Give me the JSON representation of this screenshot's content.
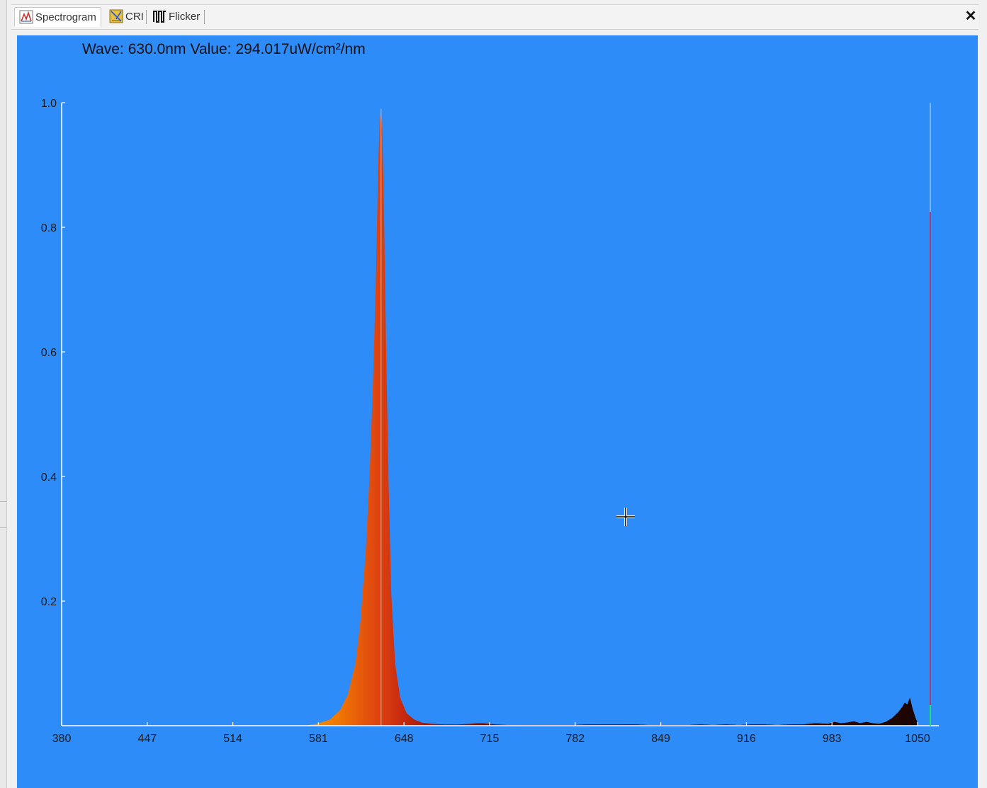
{
  "tabs": [
    {
      "label": "Spectrogram",
      "icon": "spectrogram-icon",
      "active": true
    },
    {
      "label": "CRI",
      "icon": "cri-icon",
      "active": false
    },
    {
      "label": "Flicker",
      "icon": "flicker-icon",
      "active": false
    }
  ],
  "close_label": "✕",
  "readout": {
    "wave_label": "Wave:",
    "wave_value": "630.0nm",
    "value_label": "Value:",
    "value_value": "294.017uW/cm²/nm"
  },
  "colors": {
    "background": "#2e8cf8",
    "axis": "#ffffff",
    "tick_text": "#1a1a1a",
    "cursor_line": "#b8b8b8",
    "marker_top": "#8ec5ff",
    "marker_mid": "#e0204a",
    "marker_bottom": "#22dd66"
  },
  "chart_data": {
    "type": "area",
    "title": "",
    "xlabel": "",
    "ylabel": "",
    "xlim": [
      380,
      1050
    ],
    "ylim": [
      0,
      1.0
    ],
    "x_ticks": [
      "380",
      "447",
      "514",
      "581",
      "648",
      "715",
      "782",
      "849",
      "916",
      "983",
      "1050"
    ],
    "y_ticks": [
      "0.2",
      "0.4",
      "0.6",
      "0.8",
      "1.0"
    ],
    "grid": false,
    "cursor_wavelength": 630,
    "right_marker_wavelength": 1060,
    "series": [
      {
        "x": [
          570,
          580,
          590,
          598,
          604,
          610,
          614,
          618,
          621,
          624,
          626,
          627,
          628,
          629,
          630,
          631,
          632,
          633,
          634,
          636,
          638,
          641,
          645,
          650,
          656,
          662,
          670,
          680,
          690,
          700,
          705,
          710,
          715,
          720,
          730,
          740,
          750,
          760,
          780,
          790,
          800,
          810,
          820,
          830,
          840,
          850,
          860,
          870,
          880,
          890,
          900,
          910,
          920,
          930,
          940,
          950,
          960,
          970,
          980,
          985,
          990,
          995,
          1000,
          1005,
          1010,
          1015,
          1020,
          1025,
          1030,
          1035,
          1038,
          1040,
          1042,
          1044,
          1046,
          1048,
          1050
        ],
        "values": [
          0,
          0.003,
          0.01,
          0.025,
          0.05,
          0.1,
          0.17,
          0.28,
          0.4,
          0.57,
          0.72,
          0.82,
          0.91,
          0.97,
          0.99,
          0.95,
          0.86,
          0.73,
          0.6,
          0.38,
          0.21,
          0.1,
          0.045,
          0.02,
          0.01,
          0.005,
          0.003,
          0.002,
          0.002,
          0.003,
          0.004,
          0.004,
          0.003,
          0.002,
          0.001,
          0.001,
          0.001,
          0.001,
          0.001,
          0.002,
          0.002,
          0.002,
          0.002,
          0.002,
          0.001,
          0.001,
          0.001,
          0.001,
          0.002,
          0.001,
          0.002,
          0.001,
          0.002,
          0.002,
          0.001,
          0.002,
          0.002,
          0.004,
          0.003,
          0.006,
          0.004,
          0.005,
          0.007,
          0.004,
          0.006,
          0.004,
          0.003,
          0.006,
          0.012,
          0.022,
          0.03,
          0.037,
          0.034,
          0.045,
          0.028,
          0.015,
          0.004
        ]
      }
    ]
  }
}
